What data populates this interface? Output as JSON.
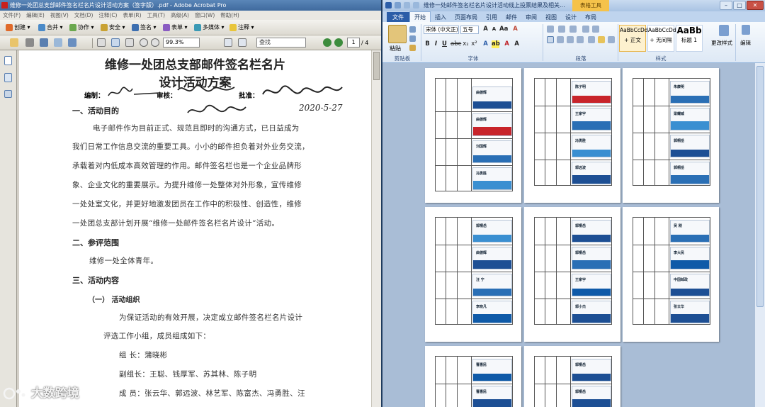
{
  "acrobat": {
    "title": "维修一处团总支部邮件签名栏名片设计活动方案（签字版）.pdf - Adobe Acrobat Pro",
    "menus": [
      "文件(F)",
      "编辑(E)",
      "视图(V)",
      "文档(D)",
      "注释(C)",
      "表单(R)",
      "工具(T)",
      "高级(A)",
      "窗口(W)",
      "帮助(H)"
    ],
    "toolbar1": [
      "创建",
      "合并",
      "协作",
      "安全",
      "签名",
      "表单",
      "多媒体",
      "注释"
    ],
    "zoom": "99.3%",
    "find_placeholder": "查找",
    "page_current": "1",
    "page_total": "/ 4",
    "document": {
      "title_line1": "维修一处团总支部邮件签名栏名片",
      "title_line2": "设计活动方案",
      "sig_labels": {
        "compile": "编制：",
        "review": "审核：",
        "approve": "批准："
      },
      "date_handwritten": "2020-5-27",
      "section1": "一、活动目的",
      "para1": [
        "电子邮件作为目前正式、规范且即时的沟通方式，已日益成为",
        "我们日常工作信息交流的重要工具。小小的邮件担负着对外业务交流，",
        "承载着对内低成本高效管理的作用。邮件签名栏也是一个企业品牌形",
        "象、企业文化的重要展示。为提升维修一处整体对外形象，宣传维修",
        "一处处室文化，并更好地激发团员在工作中的积极性、创造性，维修",
        "一处团总支部计划开展“维修一处邮件签名栏名片设计”活动。"
      ],
      "section2": "二、参评范围",
      "scope": "维修一处全体青年。",
      "section3": "三、活动内容",
      "sub1": "（一） 活动组织",
      "para2": [
        "为保证活动的有效开展，决定成立邮件签名栏名片设计",
        "评选工作小组，成员组成如下："
      ],
      "leader": "组  长：蒲晓彬",
      "deputy": "副组长：王聪、钱厚军、苏其林、陈子明",
      "members": "成  员：张云华、郭远波、林艺军、陈富杰、冯勇胜、汪"
    },
    "watermark": "大数跨境"
  },
  "word": {
    "title": "维修一处邮件签名栏名片设计活动线上投票结果及相关...",
    "table_tools": "表格工具",
    "tabs": [
      "文件",
      "开始",
      "插入",
      "页面布局",
      "引用",
      "邮件",
      "审阅",
      "视图",
      "设计",
      "布局"
    ],
    "active_tab": "开始",
    "clipboard": {
      "paste": "粘贴",
      "label": "剪贴板"
    },
    "font": {
      "name": "宋体 (中文正)",
      "size": "五号",
      "label": "字体"
    },
    "paragraph_label": "段落",
    "styles": [
      {
        "sample": "AaBbCcDd",
        "name": "+ 正文"
      },
      {
        "sample": "AaBbCcDd",
        "name": "+ 无间隔"
      },
      {
        "sample": "AaBb",
        "name": "标题 1"
      }
    ],
    "styles_label": "样式",
    "change_styles": "更改样式",
    "editing": "编辑",
    "cards": [
      [
        "曲德辉",
        "曲德辉",
        "刘国辉",
        "冯勇胜"
      ],
      [
        "陈子明",
        "王家宇",
        "冯勇胜",
        "郭远波"
      ],
      [
        "朱康明",
        "梁耀威",
        "郭桐岳",
        "郭桐岳"
      ],
      [
        "郭桐岳",
        "曲德辉",
        "汪  宁",
        "李晓凡"
      ],
      [
        "郭桐岳",
        "郭桐岳",
        "王家宇",
        "郭小杰"
      ],
      [
        "吴  刚",
        "李大民",
        "中国邮政",
        "张云华"
      ],
      [
        "曹惠民",
        "曹惠民"
      ],
      [
        "郭桐岳",
        "郭桐岳"
      ]
    ]
  }
}
